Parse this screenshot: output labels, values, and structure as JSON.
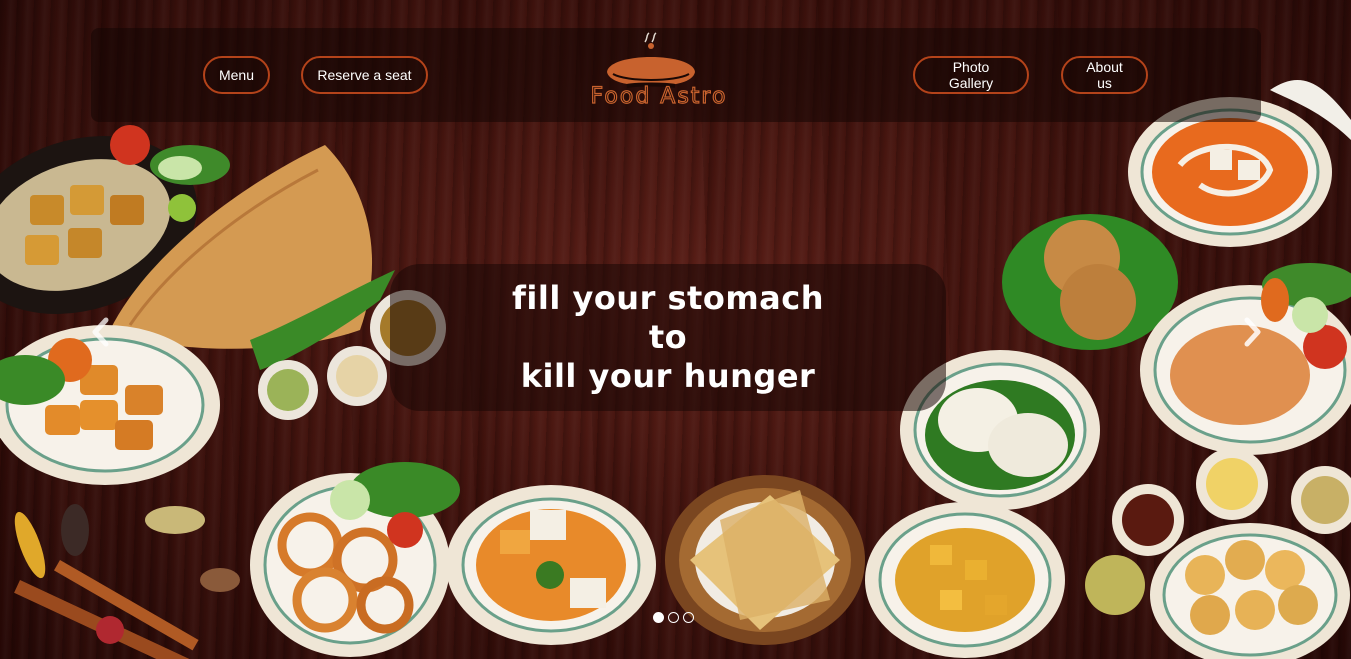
{
  "navbar": {
    "left_items": [
      {
        "label": "Menu"
      },
      {
        "label": "Reserve a seat"
      }
    ],
    "right_items": [
      {
        "label": "Photo Gallery"
      },
      {
        "label": "About us"
      }
    ],
    "logo_text": "Food Astro"
  },
  "hero": {
    "lines": [
      "fill your stomach",
      "to",
      "kill your hunger"
    ]
  },
  "carousel": {
    "slide_count": 3,
    "active_index": 0,
    "prev_icon": "chevron-left-icon",
    "next_icon": "chevron-right-icon"
  },
  "colors": {
    "accent": "#b4431a",
    "logo": "#c8622e",
    "text": "#ffffff"
  }
}
